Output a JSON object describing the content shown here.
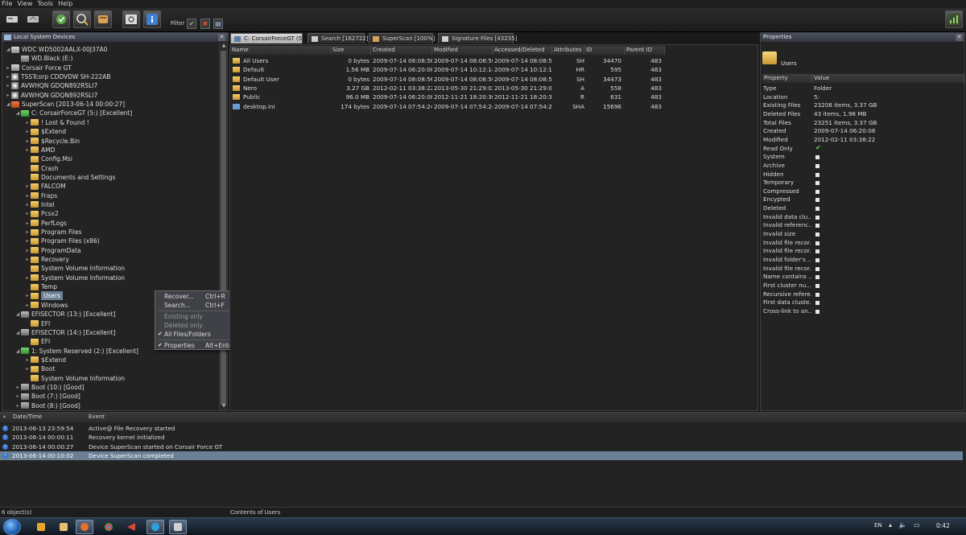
{
  "menu": [
    "File",
    "View",
    "Tools",
    "Help"
  ],
  "toolbar": {
    "filter_label": "Filter",
    "buttons": [
      "open-disk-icon",
      "open-image-icon",
      "recover-icon",
      "scan-icon",
      "map-icon",
      "view-icon",
      "info-icon"
    ],
    "filter_buttons": [
      "check-icon",
      "delete-icon",
      "file-icon"
    ]
  },
  "tree": {
    "title": "Local System Devices",
    "items": [
      {
        "indent": 0,
        "exp": "◢",
        "icon": "drive",
        "label": "WDC WD5002AALX-00J37A0"
      },
      {
        "indent": 1,
        "exp": "",
        "icon": "part",
        "label": "WD.Black (E:)"
      },
      {
        "indent": 0,
        "exp": "▸",
        "icon": "drive",
        "label": "Corsair Force GT"
      },
      {
        "indent": 0,
        "exp": "▸",
        "icon": "cd",
        "label": "TSSTcorp CDDVDW SH-222AB"
      },
      {
        "indent": 0,
        "exp": "▸",
        "icon": "cd",
        "label": "AVWHQN GDQN892RSLI7"
      },
      {
        "indent": 0,
        "exp": "▸",
        "icon": "cd",
        "label": "AVWHQN GDQN892RSLI7"
      },
      {
        "indent": 0,
        "exp": "◢",
        "icon": "scan",
        "label": "SuperScan [2013-06-14 00:00:27]"
      },
      {
        "indent": 1,
        "exp": "◢",
        "icon": "part-green",
        "label": "C: CorsairForceGT (5:) [Excellent]"
      },
      {
        "indent": 2,
        "exp": "▸",
        "icon": "folder",
        "label": "! Lost & Found !"
      },
      {
        "indent": 2,
        "exp": "▸",
        "icon": "folder",
        "label": "$Extend"
      },
      {
        "indent": 2,
        "exp": "▸",
        "icon": "folder",
        "label": "$Recycle.Bin"
      },
      {
        "indent": 2,
        "exp": "▸",
        "icon": "folder",
        "label": "AMD"
      },
      {
        "indent": 2,
        "exp": "",
        "icon": "folder",
        "label": "Config.Msi"
      },
      {
        "indent": 2,
        "exp": "",
        "icon": "folder",
        "label": "Crash"
      },
      {
        "indent": 2,
        "exp": "",
        "icon": "folder",
        "label": "Documents and Settings"
      },
      {
        "indent": 2,
        "exp": "▸",
        "icon": "folder",
        "label": "FALCOM"
      },
      {
        "indent": 2,
        "exp": "▸",
        "icon": "folder",
        "label": "Fraps"
      },
      {
        "indent": 2,
        "exp": "▸",
        "icon": "folder",
        "label": "Intel"
      },
      {
        "indent": 2,
        "exp": "▸",
        "icon": "folder",
        "label": "Pcsx2"
      },
      {
        "indent": 2,
        "exp": "▸",
        "icon": "folder",
        "label": "PerfLogs"
      },
      {
        "indent": 2,
        "exp": "▸",
        "icon": "folder",
        "label": "Program Files"
      },
      {
        "indent": 2,
        "exp": "▸",
        "icon": "folder",
        "label": "Program Files (x86)"
      },
      {
        "indent": 2,
        "exp": "▸",
        "icon": "folder",
        "label": "ProgramData"
      },
      {
        "indent": 2,
        "exp": "▸",
        "icon": "folder",
        "label": "Recovery"
      },
      {
        "indent": 2,
        "exp": "",
        "icon": "folder",
        "label": "System Volume Information"
      },
      {
        "indent": 2,
        "exp": "▸",
        "icon": "folder",
        "label": "System Volume Information"
      },
      {
        "indent": 2,
        "exp": "",
        "icon": "folder",
        "label": "Temp"
      },
      {
        "indent": 2,
        "exp": "▸",
        "icon": "folder",
        "label": "Users",
        "selected": true
      },
      {
        "indent": 2,
        "exp": "▸",
        "icon": "folder",
        "label": "Windows"
      },
      {
        "indent": 1,
        "exp": "◢",
        "icon": "part",
        "label": "EFISECTOR (13:) [Excellent]"
      },
      {
        "indent": 2,
        "exp": "",
        "icon": "folder",
        "label": "EFI"
      },
      {
        "indent": 1,
        "exp": "◢",
        "icon": "part",
        "label": "EFISECTOR (14:) [Excellent]"
      },
      {
        "indent": 2,
        "exp": "",
        "icon": "folder",
        "label": "EFI"
      },
      {
        "indent": 1,
        "exp": "◢",
        "icon": "part-green",
        "label": "1: System Reserved (2:) [Excellent]"
      },
      {
        "indent": 2,
        "exp": "▸",
        "icon": "folder",
        "label": "$Extend"
      },
      {
        "indent": 2,
        "exp": "▸",
        "icon": "folder",
        "label": "Boot"
      },
      {
        "indent": 2,
        "exp": "",
        "icon": "folder",
        "label": "System Volume Information"
      },
      {
        "indent": 1,
        "exp": "▸",
        "icon": "part",
        "label": "Boot (10:) [Good]"
      },
      {
        "indent": 1,
        "exp": "▸",
        "icon": "part",
        "label": "Boot (7:) [Good]"
      },
      {
        "indent": 1,
        "exp": "▸",
        "icon": "part",
        "label": "Boot (8:) [Good]"
      }
    ]
  },
  "context_menu": {
    "items": [
      {
        "label": "Recover...",
        "shortcut": "Ctrl+R"
      },
      {
        "label": "Search...",
        "shortcut": "Ctrl+F"
      },
      {
        "label": "Existing only",
        "disabled": true
      },
      {
        "label": "Deleted only",
        "disabled": true
      },
      {
        "label": "All Files/Folders",
        "checked": true
      },
      {
        "label": "Properties",
        "shortcut": "Alt+Enter",
        "checked": true
      }
    ]
  },
  "tabs": [
    {
      "label": "C: CorsairForceGT (5:)",
      "active": true
    },
    {
      "label": "Search [162722]"
    },
    {
      "label": "SuperScan [100%]"
    },
    {
      "label": "Signature Files [43235]"
    }
  ],
  "files": {
    "columns": [
      "Name",
      "Size",
      "Created",
      "Modified",
      "Accessed/Deleted",
      "Attributes",
      "ID",
      "Parent ID"
    ],
    "rows": [
      {
        "icon": "folder",
        "name": "All Users",
        "size": "0 bytes",
        "created": "2009-07-14 08:08:56",
        "modified": "2009-07-14 08:08:56",
        "accessed": "2009-07-14 08:08:56",
        "attr": "SH",
        "id": "34470",
        "parent": "483"
      },
      {
        "icon": "folder",
        "name": "Default",
        "size": "1.56 MB",
        "created": "2009-07-14 06:20:08",
        "modified": "2009-07-14 10:12:14",
        "accessed": "2009-07-14 10:12:14",
        "attr": "HR",
        "id": "595",
        "parent": "483"
      },
      {
        "icon": "folder",
        "name": "Default User",
        "size": "0 bytes",
        "created": "2009-07-14 08:08:56",
        "modified": "2009-07-14 08:08:56",
        "accessed": "2009-07-14 08:08:56",
        "attr": "SH",
        "id": "34473",
        "parent": "483"
      },
      {
        "icon": "folder",
        "name": "Nero",
        "size": "3.27 GB",
        "created": "2012-02-11 03:38:22",
        "modified": "2013-05-30 21:29:02",
        "accessed": "2013-05-30 21:29:02",
        "attr": "A",
        "id": "558",
        "parent": "483"
      },
      {
        "icon": "folder",
        "name": "Public",
        "size": "96.0 MB",
        "created": "2009-07-14 06:20:08",
        "modified": "2012-11-21 18:20:30",
        "accessed": "2012-11-21 18:20:30",
        "attr": "R",
        "id": "631",
        "parent": "483"
      },
      {
        "icon": "file",
        "name": "desktop.ini",
        "size": "174 bytes",
        "created": "2009-07-14 07:54:24",
        "modified": "2009-07-14 07:54:24",
        "accessed": "2009-07-14 07:54:24",
        "attr": "SHA",
        "id": "15696",
        "parent": "483"
      }
    ]
  },
  "properties": {
    "title": "Properties",
    "name": "Users",
    "columns": [
      "Property",
      "Value"
    ],
    "rows": [
      {
        "key": "Type",
        "value": "Folder"
      },
      {
        "key": "Location",
        "value": "5:"
      },
      {
        "key": "Existing Files",
        "value": "23208 items, 3.37 GB"
      },
      {
        "key": "Deleted Files",
        "value": "43 items, 1.98 MB"
      },
      {
        "key": "Total Files",
        "value": "23251 items, 3.37 GB"
      },
      {
        "key": "Created",
        "value": "2009-07-14 06:20:08"
      },
      {
        "key": "Modified",
        "value": "2012-02-11 03:38:22"
      },
      {
        "key": "Read Only",
        "check": true,
        "checked": true
      },
      {
        "key": "System",
        "check": true
      },
      {
        "key": "Archive",
        "check": true
      },
      {
        "key": "Hidden",
        "check": true
      },
      {
        "key": "Temporary",
        "check": true
      },
      {
        "key": "Compressed",
        "check": true
      },
      {
        "key": "Encypted",
        "check": true
      },
      {
        "key": "Deleted",
        "check": true
      },
      {
        "key": "Invalid data clu...",
        "check": true
      },
      {
        "key": "Invalid referenc...",
        "check": true
      },
      {
        "key": "Invalid size",
        "check": true
      },
      {
        "key": "Invalid file recor...",
        "check": true
      },
      {
        "key": "Invalid file recor...",
        "check": true
      },
      {
        "key": "Invalid folder's ...",
        "check": true
      },
      {
        "key": "Invalid file recor...",
        "check": true
      },
      {
        "key": "Name contains ...",
        "check": true
      },
      {
        "key": "First cluster nu...",
        "check": true
      },
      {
        "key": "Recursive refere...",
        "check": true
      },
      {
        "key": "First data cluste...",
        "check": true
      },
      {
        "key": "Cross-link to an...",
        "check": true
      }
    ]
  },
  "log": {
    "columns": [
      "Date/Time",
      "Event"
    ],
    "rows": [
      {
        "dt": "2013-06-13 23:59:54",
        "event": "Active@ File Recovery started"
      },
      {
        "dt": "2013-06-14 00:00:11",
        "event": "Recovery kernel initialized"
      },
      {
        "dt": "2013-06-14 00:00:27",
        "event": "Device SuperScan started on Corsair Force GT"
      },
      {
        "dt": "2013-06-14 00:10:02",
        "event": "Device SuperScan completed",
        "selected": true
      }
    ]
  },
  "status": {
    "left": "6 object(s)",
    "middle": "Contents of Users"
  },
  "taskbar": {
    "apps": [
      "explorer-icon",
      "media-player-icon",
      "folder-icon",
      "firefox-icon",
      "chrome-icon",
      "arrow-icon",
      "skype-icon",
      "file-recovery-icon"
    ],
    "lang": "EN",
    "tray": "▴ 🔈 ▭",
    "clock": "0:42"
  },
  "colors": {
    "selection": "#6b7f95",
    "folder": "#e5b54a",
    "info": "#3a79d6"
  }
}
